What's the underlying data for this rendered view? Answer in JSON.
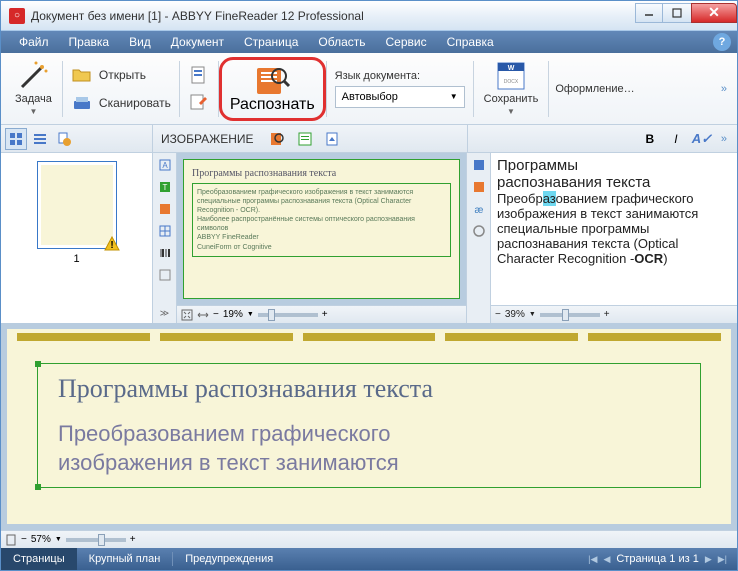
{
  "window": {
    "title": "Документ без имени [1] - ABBYY FineReader 12 Professional"
  },
  "menu": {
    "file": "Файл",
    "edit": "Правка",
    "view": "Вид",
    "document": "Документ",
    "page": "Страница",
    "area": "Область",
    "service": "Сервис",
    "help": "Справка"
  },
  "ribbon": {
    "task": "Задача",
    "open": "Открыть",
    "scan": "Сканировать",
    "recognize": "Распознать",
    "lang_label": "Язык документа:",
    "lang_value": "Автовыбор",
    "save": "Сохранить",
    "format": "Оформление…"
  },
  "secbar": {
    "image_label": "ИЗОБРАЖЕНИЕ"
  },
  "thumbs": {
    "page1": "1"
  },
  "imgpane": {
    "title": "Программы распознавания текста",
    "body": "Преобразованием графического изображения в текст занимаются специальные программы распознавания текста (Optical Character Recognition - OCR).\nНаиболее распространённые системы оптического распознавания символов\nABBYY FineReader\nCuneiForm от Cognitive",
    "zoom": "19%"
  },
  "textpane": {
    "line1a": "Программы",
    "line1b": "распознавания текста",
    "line2a": "Преобр",
    "line2hl": "аз",
    "line2b": "ованием",
    "line3": "графического изображения в текст занимаются специальные программы распознавания текста (Optical Character Recognition -",
    "line4": "OCR",
    "line4b": ")",
    "zoom": "39%"
  },
  "bigdoc": {
    "title": "Программы распознавания текста",
    "body1": "Преобразованием графического",
    "body2": "изображения в текст занимаются",
    "zoom": "57%"
  },
  "status": {
    "pages": "Страницы",
    "bigplan": "Крупный план",
    "warnings": "Предупреждения",
    "pager": "Страница 1 из 1"
  }
}
